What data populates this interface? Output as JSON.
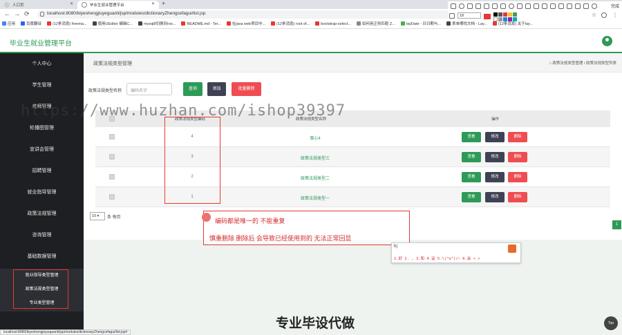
{
  "browser": {
    "tabs": [
      {
        "label": "人口页"
      },
      {
        "label": "毕业生就业管理平台"
      }
    ],
    "new_tab_icon": "+",
    "nav": {
      "back": "←",
      "forward": "→",
      "reload": "⟳"
    },
    "url": "localhost:8080/biyeshengjiuyeguanli/jsp/modules/dictionaryZhengcefagui/list.jsp",
    "bookmarks": [
      {
        "label": "应用",
        "color": "#4285f4"
      },
      {
        "label": "百度翻译",
        "color": "#2962ff"
      },
      {
        "label": "(12条消息) freema...",
        "color": "#e53935"
      },
      {
        "label": "使用UEditor 编辑C...",
        "color": "#444444"
      },
      {
        "label": "mysql8切换到roo...",
        "color": "#444444"
      },
      {
        "label": "README.md - Ter...",
        "color": "#e53935"
      },
      {
        "label": "在java web项目中...",
        "color": "#e53935"
      },
      {
        "label": "(12条消息) root of...",
        "color": "#e53935"
      },
      {
        "label": "bootstrap-select...",
        "color": "#e53935"
      },
      {
        "label": "如何用正则匹配 Z...",
        "color": "#888888"
      },
      {
        "label": "layDate - 日日期与...",
        "color": "#4caf50"
      },
      {
        "label": "表单哪找文档 - Lay...",
        "color": "#444444"
      },
      {
        "label": "(12条消息) 关于lay...",
        "color": "#e53935"
      }
    ],
    "ext_toolbar": {
      "done_label": "完成",
      "font_size": "18"
    },
    "status_url": "localhost:8080/biyeshengjiuyeguanli/jsp/modules/dictionaryZhengcefagui/list.jsp#"
  },
  "app": {
    "title": "毕业生就业管理平台",
    "brand_color": "#2d9a56"
  },
  "sidebar": {
    "items": [
      {
        "label": "个人中心"
      },
      {
        "label": "学生管理"
      },
      {
        "label": "老师管理"
      },
      {
        "label": "轮播图管理"
      },
      {
        "label": "宣讲会管理"
      },
      {
        "label": "招聘管理"
      },
      {
        "label": "就业指导管理"
      },
      {
        "label": "政策法规管理"
      },
      {
        "label": "咨询管理"
      },
      {
        "label": "基础数据管理"
      }
    ],
    "sub_items": [
      {
        "label": "就业指导类型管理"
      },
      {
        "label": "政策法规类型管理"
      },
      {
        "label": "专业类型管理"
      }
    ]
  },
  "main": {
    "page_title": "政策法规类型管理",
    "breadcrumb": [
      "政策法规类型管理",
      "政策法规类型列表"
    ],
    "search": {
      "label": "政策法规类型名称",
      "placeholder": "编码名字",
      "query_button": "查询",
      "add_button": "添加",
      "batch_delete_button": "批量删除"
    },
    "table": {
      "headers": [
        "政策法规类型编码",
        "政策法规类型名称",
        "操作"
      ],
      "rows": [
        {
          "code": "4",
          "name": "案心4"
        },
        {
          "code": "3",
          "name": "政策法规类型三"
        },
        {
          "code": "2",
          "name": "政策法规类型二"
        },
        {
          "code": "1",
          "name": "政策法规类型一"
        }
      ],
      "actions": {
        "view": "查看",
        "edit": "修改",
        "delete": "删除"
      }
    },
    "pager": {
      "page_size": "10",
      "page_size_label": "条 每页",
      "current_page": "1"
    }
  },
  "annotation": {
    "line1": "编码都是唯一的 不能重复",
    "line2": "慎重删除  删除后 会导致已经使用到的 无法正常回显"
  },
  "ime": {
    "input": "h|",
    "candidates": "1.好 2.  , 3.和 4.话 5.\\(^o^)/~ 6.会  < >"
  },
  "promo_text": "专业毕设代做",
  "back_to_top": "Top",
  "watermark": "https://www.huzhan.com/ishop39397"
}
